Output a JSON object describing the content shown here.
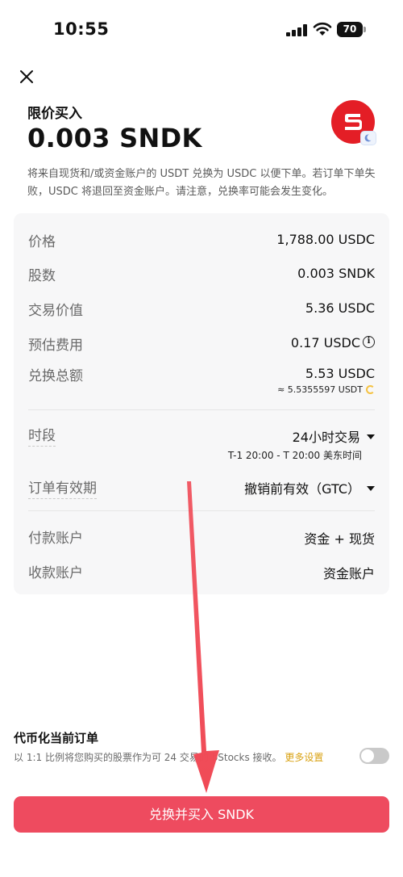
{
  "status_bar": {
    "time": "10:55",
    "battery": "70"
  },
  "header": {
    "order_type": "限价买入",
    "order_amount": "0.003 SNDK",
    "logo_icon": "sandisk-logo-icon",
    "badge_icon": "moon-icon"
  },
  "notice": "将来自现货和/或资金账户的 USDT 兑换为 USDC 以便下单。若订单下单失败，USDC 将退回至资金账户。请注意，兑换率可能会发生变化。",
  "details": {
    "price": {
      "label": "价格",
      "value": "1,788.00 USDC"
    },
    "shares": {
      "label": "股数",
      "value": "0.003 SNDK"
    },
    "trade_value": {
      "label": "交易价值",
      "value": "5.36 USDC"
    },
    "est_fee": {
      "label": "预估费用",
      "value": "0.17 USDC",
      "icon": "info-icon"
    },
    "conversion_total": {
      "label": "兑换总额",
      "value": "5.53 USDC",
      "sub": "≈ 5.5355597 USDT"
    },
    "session": {
      "label": "时段",
      "value": "24小时交易",
      "sub": "T-1 20:00 - T 20:00 美东时间"
    },
    "validity": {
      "label": "订单有效期",
      "value": "撤销前有效（GTC）"
    },
    "payment_account": {
      "label": "付款账户",
      "value": "资金 + 现货"
    },
    "receiving_account": {
      "label": "收款账户",
      "value": "资金账户"
    }
  },
  "tokenize": {
    "title": "代币化当前订单",
    "desc": "以 1:1 比例将您购买的股票作为可 24 交易的 bStocks 接收。",
    "link": "更多设置",
    "enabled": false
  },
  "submit_label": "兑换并买入 SNDK",
  "colors": {
    "accent": "#ee4b5f",
    "annotation_arrow": "#f04a56",
    "link": "#d9a213",
    "brand_red": "#e41e26"
  }
}
